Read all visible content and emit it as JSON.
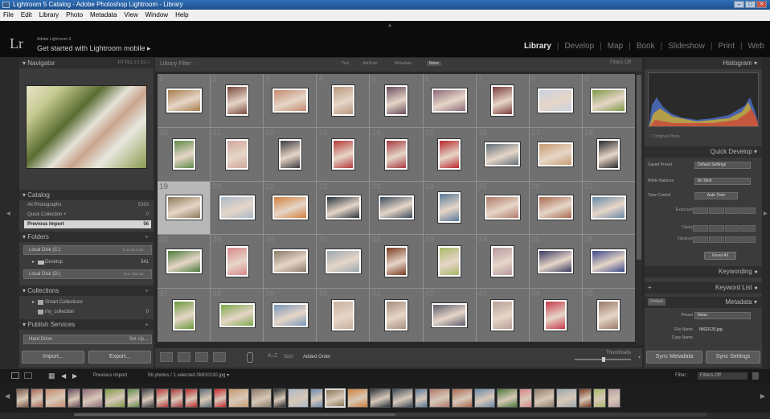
{
  "window": {
    "title": "Lightroom 5 Catalog - Adobe Photoshop Lightroom - Library",
    "controls": [
      "–",
      "□",
      "×"
    ]
  },
  "menu": [
    "File",
    "Edit",
    "Library",
    "Photo",
    "Metadata",
    "View",
    "Window",
    "Help"
  ],
  "identity": {
    "logo": "Lr",
    "sub": "Adobe Lightroom 5",
    "main": "Get started with Lightroom mobile ▸"
  },
  "modules": [
    "Library",
    "Develop",
    "Map",
    "Book",
    "Slideshow",
    "Print",
    "Web"
  ],
  "active_module": "Library",
  "navigator": {
    "title": "Navigator",
    "options": "FIT  FILL  1:1  3:1 ÷"
  },
  "catalog": {
    "title": "Catalog",
    "items": [
      {
        "label": "All Photographs",
        "count": "5363"
      },
      {
        "label": "Quick Collection +",
        "count": "0"
      },
      {
        "label": "Previous Import",
        "count": "56"
      }
    ]
  },
  "folders": {
    "title": "Folders",
    "drives": [
      {
        "label": "Local Disk (C:)",
        "capacity": "37.6 / 99.9 GB",
        "count": ""
      },
      {
        "label": "Local Disk (D:)",
        "capacity": "75.2 / 368 GB",
        "count": ""
      }
    ],
    "subfolder": {
      "label": "Desktop",
      "count": "341"
    }
  },
  "collections": {
    "title": "Collections",
    "items": [
      {
        "label": "Smart Collections",
        "count": ""
      },
      {
        "label": "my_collection",
        "count": "0"
      }
    ]
  },
  "publish": {
    "title": "Publish Services",
    "items": [
      {
        "label": "Hard Drive",
        "count": "Set Up..."
      }
    ]
  },
  "left_buttons": {
    "import": "Import...",
    "export": "Export..."
  },
  "filter_bar": {
    "label": "Library Filter :",
    "options": [
      "Text",
      "Attribute",
      "Metadata",
      "None"
    ],
    "selected": "None",
    "filters": "Filters Off"
  },
  "grid": {
    "selected_index": 18,
    "cells": [
      {
        "n": "1",
        "o": "l",
        "c": "#a77b4a"
      },
      {
        "n": "2",
        "o": "p",
        "c": "#7a4a3c"
      },
      {
        "n": "3",
        "o": "l",
        "c": "#c48a6c"
      },
      {
        "n": "4",
        "o": "p",
        "c": "#b9987e"
      },
      {
        "n": "5",
        "o": "p",
        "c": "#6a4c5c"
      },
      {
        "n": "6",
        "o": "l",
        "c": "#8d6a78"
      },
      {
        "n": "7",
        "o": "p",
        "c": "#7a3a3a"
      },
      {
        "n": "8",
        "o": "l",
        "c": "#c8d2e0"
      },
      {
        "n": "9",
        "o": "l",
        "c": "#7d9a48"
      },
      {
        "n": "10",
        "o": "p",
        "c": "#5f8c4a"
      },
      {
        "n": "11",
        "o": "p",
        "c": "#d0a89c"
      },
      {
        "n": "12",
        "o": "p",
        "c": "#3c3c40"
      },
      {
        "n": "13",
        "o": "p",
        "c": "#b63a3a"
      },
      {
        "n": "14",
        "o": "p",
        "c": "#a83a40"
      },
      {
        "n": "15",
        "o": "p",
        "c": "#b8282c"
      },
      {
        "n": "16",
        "o": "l",
        "c": "#606f78"
      },
      {
        "n": "17",
        "o": "l",
        "c": "#c89c70"
      },
      {
        "n": "18",
        "o": "p",
        "c": "#2a2a2a"
      },
      {
        "n": "19",
        "o": "l",
        "c": "#8a7a5a"
      },
      {
        "n": "20",
        "o": "l",
        "c": "#a8b8c8"
      },
      {
        "n": "21",
        "o": "l",
        "c": "#d0803c"
      },
      {
        "n": "22",
        "o": "l",
        "c": "#28343c"
      },
      {
        "n": "23",
        "o": "l",
        "c": "#3c4c5c"
      },
      {
        "n": "24",
        "o": "p",
        "c": "#5a7a9a"
      },
      {
        "n": "25",
        "o": "l",
        "c": "#b07a6a"
      },
      {
        "n": "26",
        "o": "l",
        "c": "#a86a50"
      },
      {
        "n": "27",
        "o": "l",
        "c": "#6a8aa8"
      },
      {
        "n": "28",
        "o": "l",
        "c": "#4a7a3a"
      },
      {
        "n": "29",
        "o": "p",
        "c": "#d8888a"
      },
      {
        "n": "30",
        "o": "l",
        "c": "#8c7c6c"
      },
      {
        "n": "31",
        "o": "l",
        "c": "#9aa8b0"
      },
      {
        "n": "32",
        "o": "p",
        "c": "#7a3a20"
      },
      {
        "n": "33",
        "o": "p",
        "c": "#a8b868"
      },
      {
        "n": "34",
        "o": "p",
        "c": "#b89aa0"
      },
      {
        "n": "35",
        "o": "l",
        "c": "#3a3a60"
      },
      {
        "n": "36",
        "o": "l",
        "c": "#3c4a8c"
      },
      {
        "n": "37",
        "o": "p",
        "c": "#6a9a3c"
      },
      {
        "n": "38",
        "o": "l",
        "c": "#7aa84a"
      },
      {
        "n": "39",
        "o": "l",
        "c": "#7898b8"
      },
      {
        "n": "40",
        "o": "p",
        "c": "#c8b0a0"
      },
      {
        "n": "41",
        "o": "p",
        "c": "#a89080"
      },
      {
        "n": "42",
        "o": "l",
        "c": "#5a5a6a"
      },
      {
        "n": "43",
        "o": "p",
        "c": "#b8a098"
      },
      {
        "n": "44",
        "o": "p",
        "c": "#c83a4a"
      },
      {
        "n": "45",
        "o": "p",
        "c": "#9a7a6a"
      }
    ]
  },
  "toolbar": {
    "sort_label": "Sort:",
    "sort_value": "Added Order",
    "thumbnails": "Thumbnails"
  },
  "histogram": {
    "title": "Histogram",
    "original_photo": "Original Photo"
  },
  "quick_develop": {
    "title": "Quick Develop",
    "saved_preset_label": "Saved Preset",
    "saved_preset_value": "Default Settings",
    "white_balance_label": "White Balance",
    "white_balance_value": "As Shot",
    "tone_control_label": "Tone Control",
    "auto_tone": "Auto Tone",
    "exposure": "Exposure",
    "clarity": "Clarity",
    "vibrance": "Vibrance",
    "reset_all": "Reset All"
  },
  "keywording": {
    "title": "Keywording"
  },
  "keyword_list": {
    "title": "Keyword List"
  },
  "metadata": {
    "title": "Metadata",
    "mode": "Default",
    "preset_label": "Preset",
    "preset_value": "None",
    "file_name_label": "File Name",
    "file_name_value": "IMG0130.jpg",
    "copy_name_label": "Copy Name"
  },
  "right_buttons": {
    "sync_metadata": "Sync Metadata",
    "sync_settings": "Sync Settings"
  },
  "filmstrip": {
    "source": "Previous Import",
    "info": "56 photos / 1 selected /IMG0130.jpg ▾",
    "filter_label": "Filter :",
    "filter_value": "Filters Off",
    "selected_index": 18,
    "thumbs": [
      {
        "o": "p",
        "c": "#7a5a4a"
      },
      {
        "o": "p",
        "c": "#a86a5a"
      },
      {
        "o": "l",
        "c": "#c48a6c"
      },
      {
        "o": "p",
        "c": "#6a4c5c"
      },
      {
        "o": "l",
        "c": "#8d6a78"
      },
      {
        "o": "l",
        "c": "#7d9a48"
      },
      {
        "o": "p",
        "c": "#5f8c4a"
      },
      {
        "o": "p",
        "c": "#3c3c40"
      },
      {
        "o": "p",
        "c": "#b63a3a"
      },
      {
        "o": "p",
        "c": "#a83a40"
      },
      {
        "o": "p",
        "c": "#b8282c"
      },
      {
        "o": "p",
        "c": "#606f78"
      },
      {
        "o": "p",
        "c": "#c8282c"
      },
      {
        "o": "l",
        "c": "#c89c70"
      },
      {
        "o": "l",
        "c": "#8a7a6a"
      },
      {
        "o": "p",
        "c": "#2a2a2a"
      },
      {
        "o": "l",
        "c": "#a8b8c8"
      },
      {
        "o": "p",
        "c": "#6a8ab0"
      },
      {
        "o": "l",
        "c": "#8a7a5a"
      },
      {
        "o": "l",
        "c": "#d0803c"
      },
      {
        "o": "l",
        "c": "#28343c"
      },
      {
        "o": "l",
        "c": "#3c4c5c"
      },
      {
        "o": "p",
        "c": "#5a7a9a"
      },
      {
        "o": "l",
        "c": "#b07a6a"
      },
      {
        "o": "l",
        "c": "#a86a50"
      },
      {
        "o": "l",
        "c": "#6a8aa8"
      },
      {
        "o": "l",
        "c": "#4a7a3a"
      },
      {
        "o": "p",
        "c": "#d8888a"
      },
      {
        "o": "l",
        "c": "#8c7c6c"
      },
      {
        "o": "l",
        "c": "#9aa8b0"
      },
      {
        "o": "p",
        "c": "#7a3a20"
      },
      {
        "o": "p",
        "c": "#a8b868"
      },
      {
        "o": "p",
        "c": "#b89aa0"
      }
    ]
  }
}
